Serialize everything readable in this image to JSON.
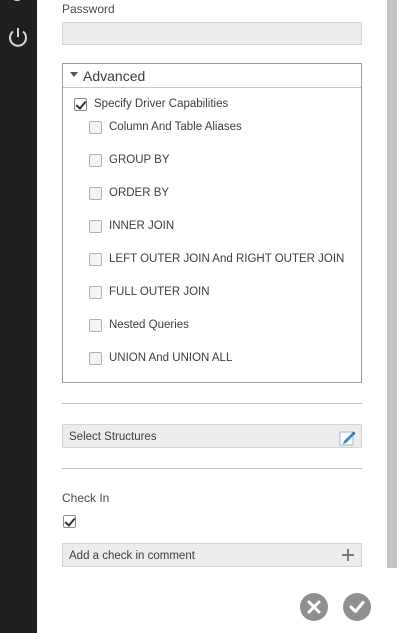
{
  "sidebar": {
    "icons": [
      "gear-icon",
      "power-icon"
    ]
  },
  "form": {
    "password_label": "Password",
    "password_value": "",
    "advanced": {
      "title": "Advanced",
      "expanded": true,
      "specify_driver_capabilities": {
        "label": "Specify Driver Capabilities",
        "checked": true
      },
      "options": [
        {
          "label": "Column And Table Aliases",
          "checked": false
        },
        {
          "label": "GROUP BY",
          "checked": false
        },
        {
          "label": "ORDER BY",
          "checked": false
        },
        {
          "label": "INNER JOIN",
          "checked": false
        },
        {
          "label": "LEFT OUTER JOIN And RIGHT OUTER JOIN",
          "checked": false
        },
        {
          "label": "FULL OUTER JOIN",
          "checked": false
        },
        {
          "label": "Nested Queries",
          "checked": false
        },
        {
          "label": "UNION And UNION ALL",
          "checked": false
        }
      ]
    },
    "select_structures": {
      "label": "Select Structures",
      "icon": "edit-pencil-icon"
    },
    "check_in": {
      "label": "Check In",
      "checked": true
    },
    "comment": {
      "label": "Add a check in comment",
      "icon": "plus-icon"
    }
  },
  "footer": {
    "cancel_icon": "close-icon",
    "confirm_icon": "checkmark-icon"
  },
  "colors": {
    "sidebar": "#1f1f1f",
    "field_bg": "#ececec",
    "round_button": "#8f8f8f",
    "scrollbar": "#c4c4c4"
  }
}
